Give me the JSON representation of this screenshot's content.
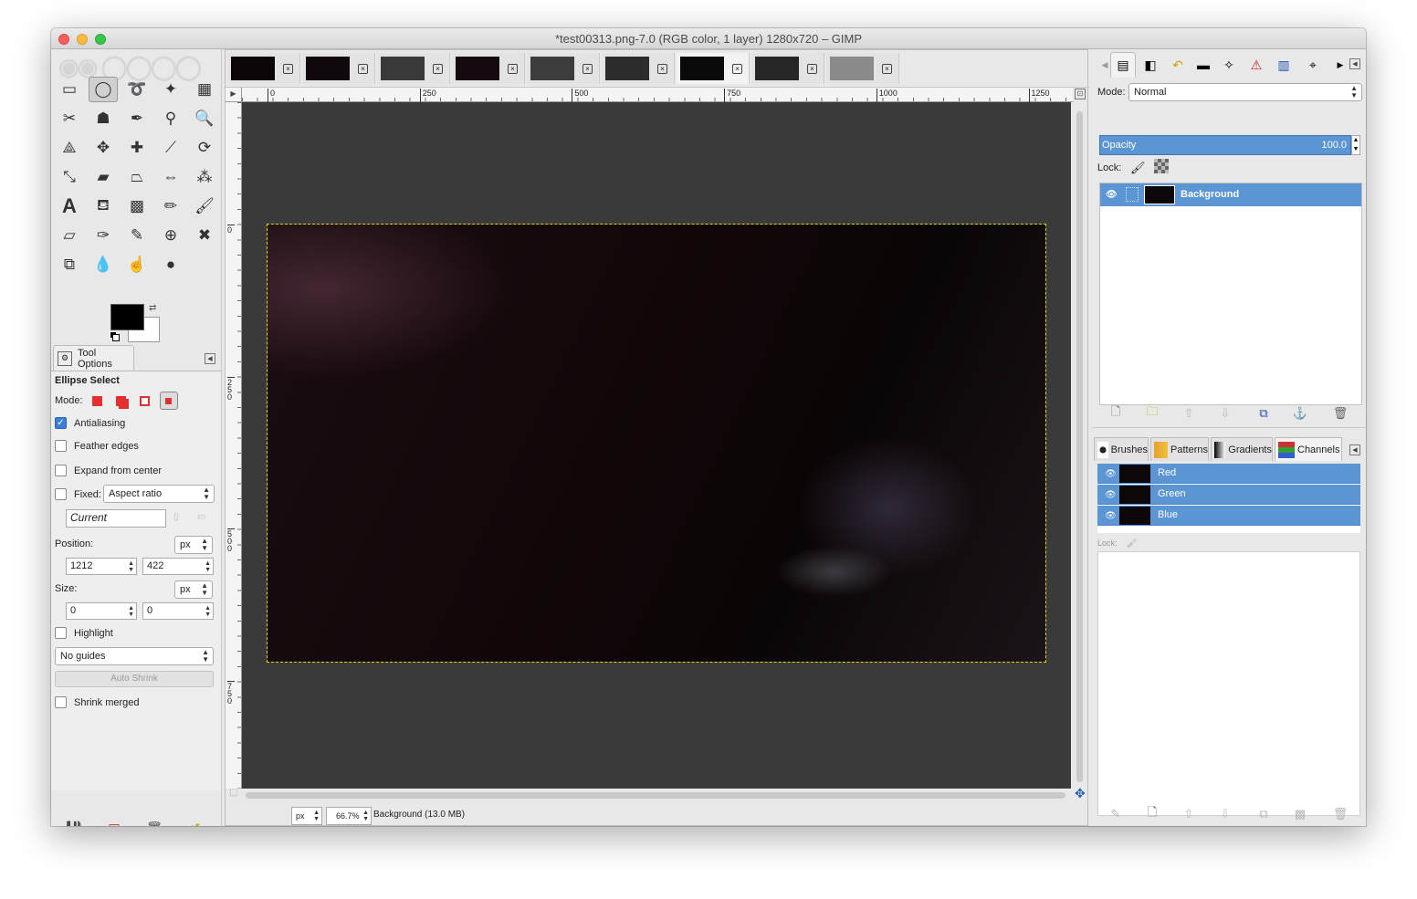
{
  "window": {
    "title": "*test00313.png-7.0 (RGB color, 1 layer) 1280x720 – GIMP"
  },
  "toolbox": {
    "tools": [
      {
        "name": "rect-select-icon",
        "glyph": "▭"
      },
      {
        "name": "ellipse-select-icon",
        "glyph": "◯",
        "active": true
      },
      {
        "name": "free-select-icon",
        "glyph": "➰"
      },
      {
        "name": "fuzzy-select-icon",
        "glyph": "✦"
      },
      {
        "name": "color-select-icon",
        "glyph": "▦"
      },
      {
        "name": "scissors-select-icon",
        "glyph": "✂"
      },
      {
        "name": "foreground-select-icon",
        "glyph": "☗"
      },
      {
        "name": "paths-icon",
        "glyph": "✒"
      },
      {
        "name": "color-picker-icon",
        "glyph": "⚲"
      },
      {
        "name": "zoom-icon",
        "glyph": "🔍"
      },
      {
        "name": "measure-icon",
        "glyph": "⟁"
      },
      {
        "name": "move-icon",
        "glyph": "✥"
      },
      {
        "name": "align-icon",
        "glyph": "✚"
      },
      {
        "name": "crop-icon",
        "glyph": "⟋"
      },
      {
        "name": "rotate-icon",
        "glyph": "⟳"
      },
      {
        "name": "scale-icon",
        "glyph": "⤡"
      },
      {
        "name": "shear-icon",
        "glyph": "▰"
      },
      {
        "name": "perspective-icon",
        "glyph": "⏢"
      },
      {
        "name": "flip-icon",
        "glyph": "⇔"
      },
      {
        "name": "cage-transform-icon",
        "glyph": "⁂"
      },
      {
        "name": "text-icon",
        "glyph": "A"
      },
      {
        "name": "bucket-fill-icon",
        "glyph": "⛾"
      },
      {
        "name": "blend-icon",
        "glyph": "▩"
      },
      {
        "name": "pencil-icon",
        "glyph": "✏"
      },
      {
        "name": "paintbrush-icon",
        "glyph": "🖌"
      },
      {
        "name": "eraser-icon",
        "glyph": "▱"
      },
      {
        "name": "airbrush-icon",
        "glyph": "✑"
      },
      {
        "name": "ink-icon",
        "glyph": "✎"
      },
      {
        "name": "clone-icon",
        "glyph": "⊕"
      },
      {
        "name": "heal-icon",
        "glyph": "✖"
      },
      {
        "name": "perspective-clone-icon",
        "glyph": "⧉"
      },
      {
        "name": "blur-icon",
        "glyph": "💧"
      },
      {
        "name": "smudge-icon",
        "glyph": "☝"
      },
      {
        "name": "dodge-burn-icon",
        "glyph": "●"
      }
    ],
    "options_tab": "Tool Options",
    "tool_name": "Ellipse Select",
    "mode_label": "Mode:",
    "antialiasing": "Antialiasing",
    "feather_edges": "Feather edges",
    "expand_from_center": "Expand from center",
    "fixed_label": "Fixed:",
    "fixed_value": "Aspect ratio",
    "current_value": "Current",
    "position_label": "Position:",
    "position_unit": "px",
    "position_x": "1212",
    "position_y": "422",
    "size_label": "Size:",
    "size_unit": "px",
    "size_w": "0",
    "size_h": "0",
    "highlight": "Highlight",
    "guides_value": "No guides",
    "auto_shrink": "Auto Shrink",
    "shrink_merged": "Shrink merged"
  },
  "canvas": {
    "ruler_h": [
      "0",
      "250",
      "500",
      "750",
      "1000",
      "1250"
    ],
    "ruler_v": [
      "0",
      "250",
      "500",
      "750"
    ],
    "unit": "px",
    "zoom": "66.7%",
    "status": "Background (13.0 MB)"
  },
  "layers": {
    "mode_label": "Mode:",
    "mode_value": "Normal",
    "opacity_label": "Opacity",
    "opacity_value": "100.0",
    "lock_label": "Lock:",
    "layer_name": "Background"
  },
  "channels": {
    "tabs": [
      "Brushes",
      "Patterns",
      "Gradients",
      "Channels"
    ],
    "items": [
      "Red",
      "Green",
      "Blue"
    ],
    "lock_label": "Lock:"
  },
  "colors": {
    "selection": "#5b95d4",
    "canvas_bg": "#3a3a3a",
    "foreground": "#000000",
    "background": "#ffffff"
  }
}
